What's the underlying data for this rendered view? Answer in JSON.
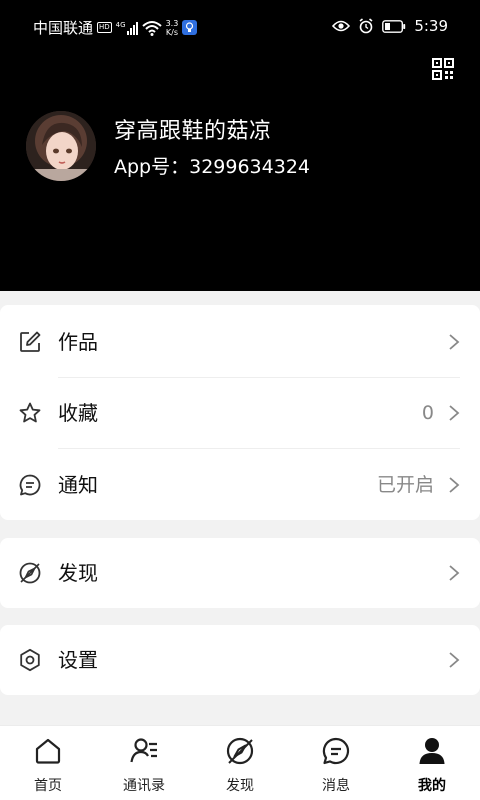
{
  "status_bar": {
    "carrier": "中国联通",
    "hd": "HD",
    "network": "4G",
    "speed_value": "3.3",
    "speed_unit": "K/s",
    "time": "5:39"
  },
  "profile": {
    "name": "穿高跟鞋的菇凉",
    "app_id": "App号：3299634324"
  },
  "menu_group_1": [
    {
      "label": "作品",
      "value": "",
      "icon": "edit-icon"
    },
    {
      "label": "收藏",
      "value": "0",
      "icon": "star-icon"
    },
    {
      "label": "通知",
      "value": "已开启",
      "icon": "message-icon"
    }
  ],
  "menu_group_2": [
    {
      "label": "发现",
      "value": "",
      "icon": "compass-icon"
    }
  ],
  "menu_group_3": [
    {
      "label": "设置",
      "value": "",
      "icon": "gear-icon"
    }
  ],
  "bottom_nav": [
    {
      "label": "首页",
      "icon": "home-icon",
      "active": false
    },
    {
      "label": "通讯录",
      "icon": "contacts-icon",
      "active": false
    },
    {
      "label": "发现",
      "icon": "compass-icon",
      "active": false
    },
    {
      "label": "消息",
      "icon": "message-icon",
      "active": false
    },
    {
      "label": "我的",
      "icon": "person-icon",
      "active": true
    }
  ],
  "colors": {
    "header_bg": "#000000",
    "page_bg": "#f2f2f2",
    "accent": "#111111",
    "muted": "#888888"
  }
}
